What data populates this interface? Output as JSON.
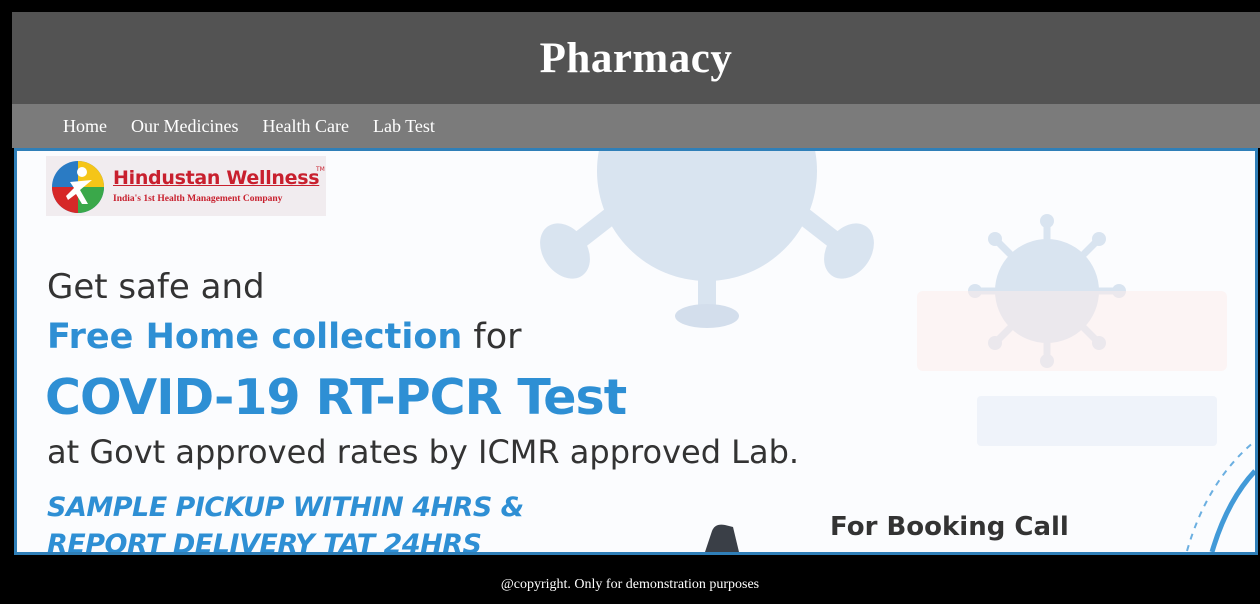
{
  "header": {
    "title": "Pharmacy"
  },
  "nav": {
    "items": [
      {
        "label": "Home"
      },
      {
        "label": "Our Medicines"
      },
      {
        "label": "Health Care"
      },
      {
        "label": "Lab Test"
      }
    ]
  },
  "banner": {
    "logo": {
      "brand": "Hindustan Wellness",
      "tm": "TM",
      "tagline": "India's 1st Health Management Company"
    },
    "headline_line1": "Get safe and",
    "headline_line2_highlight": "Free Home collection",
    "headline_line2_rest": " for",
    "headline_line3": "COVID-19 RT-PCR Test",
    "headline_line4": "at Govt approved rates by ICMR approved Lab.",
    "promo_line1": "SAMPLE PICKUP WITHIN 4HRS &",
    "promo_line2": "REPORT DELIVERY TAT 24HRS",
    "booking_label": "For Booking Call",
    "accent_color": "#2e8fd4",
    "border_color": "#2f7fb8"
  },
  "footer": {
    "text": "@copyright. Only for demonstration purposes"
  }
}
